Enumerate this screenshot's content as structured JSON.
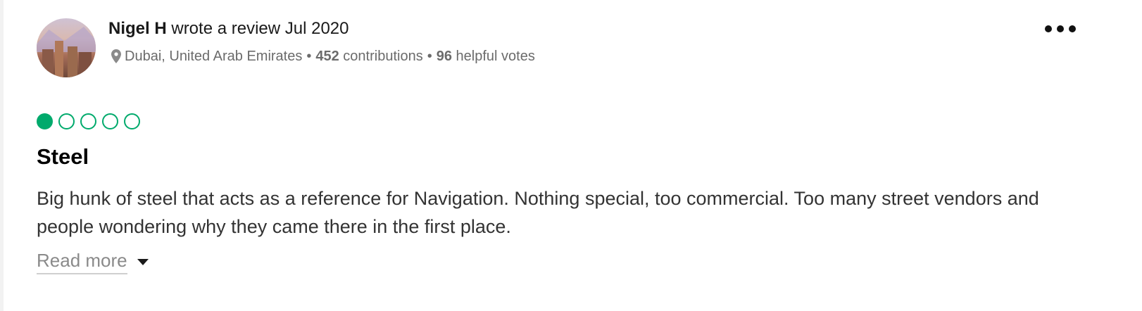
{
  "review": {
    "author": "Nigel H",
    "action_text": "wrote a review Jul 2020",
    "location": "Dubai, United Arab Emirates",
    "contributions_count": "452",
    "contributions_label": "contributions",
    "helpful_count": "96",
    "helpful_label": "helpful votes",
    "separator": "•",
    "rating": 1,
    "rating_max": 5,
    "title": "Steel",
    "body": "Big hunk of steel that acts as a reference for Navigation. Nothing special, too commercial. Too many street vendors and people wondering why they came there in the first place.",
    "read_more_label": "Read more"
  },
  "icons": {
    "location": "map-pin-icon",
    "more": "more-options-icon",
    "expand": "caret-down-icon"
  },
  "colors": {
    "rating_green": "#00aa6c",
    "meta_text": "#6b6b6b"
  }
}
